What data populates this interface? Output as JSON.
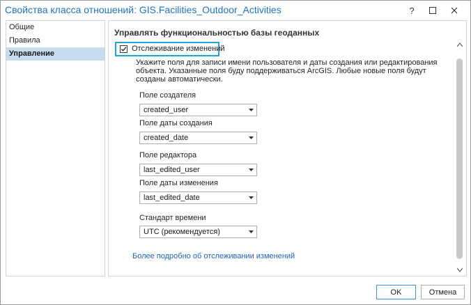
{
  "window": {
    "title": "Свойства класса отношений: GIS.Facilities_Outdoor_Activities",
    "help_glyph": "?",
    "title_color": "#1e73be"
  },
  "sidebar": {
    "items": [
      {
        "label": "Общие",
        "active": false
      },
      {
        "label": "Правила",
        "active": false
      },
      {
        "label": "Управление",
        "active": true
      }
    ]
  },
  "main": {
    "section_title": "Управлять функциональностью базы геоданных",
    "tracking_checkbox": {
      "label": "Отслеживание изменений",
      "checked": true
    },
    "description": "Укажите поля для записи имени пользователя и даты создания или редактирования объекта. Указанные поля буду поддерживаться ArcGIS. Любые новые поля будут созданы автоматически.",
    "fields": [
      {
        "label": "Поле создателя",
        "value": "created_user"
      },
      {
        "label": "Поле даты создания",
        "value": "created_date"
      },
      {
        "label": "Поле редактора",
        "value": "last_edited_user"
      },
      {
        "label": "Поле даты изменения",
        "value": "last_edited_date"
      },
      {
        "label": "Стандарт времени",
        "value": "UTC (рекомендуется)"
      }
    ],
    "link": "Более подробно об отслеживании изменений"
  },
  "footer": {
    "ok_label": "OK",
    "cancel_label": "Отмена"
  },
  "colors": {
    "accent": "#1fa3dc",
    "link": "#1e63b5",
    "selected_bg": "#c6dcef"
  },
  "icons": [
    "question-icon",
    "maximize-icon",
    "close-icon",
    "checkmark-icon",
    "dropdown-arrow-icon",
    "scroll-up-icon",
    "scroll-down-icon"
  ]
}
